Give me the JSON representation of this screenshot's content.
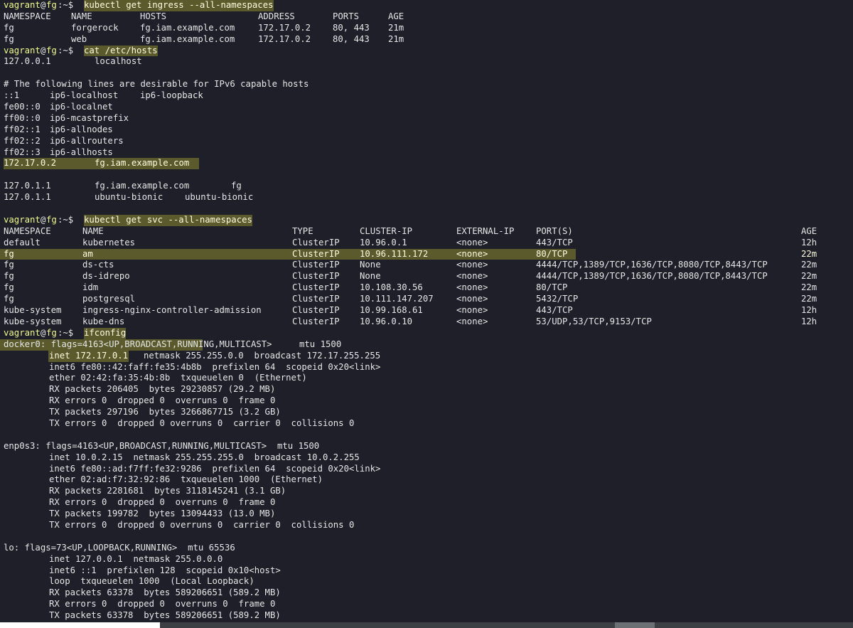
{
  "prompt": {
    "user": "vagrant",
    "at": "@",
    "host": "fg",
    "sep": ":~$ "
  },
  "cmd1": "kubectl get ingress --all-namespaces",
  "ingress": {
    "headers": [
      "NAMESPACE",
      "NAME",
      "HOSTS",
      "ADDRESS",
      "PORTS",
      "AGE"
    ],
    "rows": [
      [
        "fg",
        "forgerock",
        "fg.iam.example.com",
        "172.17.0.2",
        "80, 443",
        "21m"
      ],
      [
        "fg",
        "web",
        "fg.iam.example.com",
        "172.17.0.2",
        "80, 443",
        "21m"
      ]
    ]
  },
  "cmd2": "cat /etc/hosts",
  "hosts": {
    "l1a": "127.0.0.1",
    "l1b": "localhost",
    "comment": "# The following lines are desirable for IPv6 capable hosts",
    "v6": [
      [
        "::1",
        "ip6-localhost",
        "ip6-loopback"
      ],
      [
        "fe00::0",
        "ip6-localnet",
        ""
      ],
      [
        "ff00::0",
        "ip6-mcastprefix",
        ""
      ],
      [
        "ff02::1",
        "ip6-allnodes",
        ""
      ],
      [
        "ff02::2",
        "ip6-allrouters",
        ""
      ],
      [
        "ff02::3",
        "ip6-allhosts",
        ""
      ]
    ],
    "hl_ip": "172.17.0.2",
    "hl_host": "fg.iam.example.com",
    "e1": [
      "127.0.1.1",
      "fg.iam.example.com",
      "fg"
    ],
    "e2": [
      "127.0.1.1",
      "ubuntu-bionic",
      "ubuntu-bionic"
    ]
  },
  "cmd3": "kubectl get svc --all-namespaces",
  "svc": {
    "headers": [
      "NAMESPACE",
      "NAME",
      "TYPE",
      "CLUSTER-IP",
      "EXTERNAL-IP",
      "PORT(S)",
      "AGE"
    ],
    "rows": [
      [
        "default",
        "kubernetes",
        "ClusterIP",
        "10.96.0.1",
        "<none>",
        "443/TCP",
        "12h"
      ],
      [
        "fg",
        "am",
        "ClusterIP",
        "10.96.111.172",
        "<none>",
        "80/TCP",
        "22m"
      ],
      [
        "fg",
        "ds-cts",
        "ClusterIP",
        "None",
        "<none>",
        "4444/TCP,1389/TCP,1636/TCP,8080/TCP,8443/TCP",
        "22m"
      ],
      [
        "fg",
        "ds-idrepo",
        "ClusterIP",
        "None",
        "<none>",
        "4444/TCP,1389/TCP,1636/TCP,8080/TCP,8443/TCP",
        "22m"
      ],
      [
        "fg",
        "idm",
        "ClusterIP",
        "10.108.30.56",
        "<none>",
        "80/TCP",
        "22m"
      ],
      [
        "fg",
        "postgresql",
        "ClusterIP",
        "10.111.147.207",
        "<none>",
        "5432/TCP",
        "22m"
      ],
      [
        "kube-system",
        "ingress-nginx-controller-admission",
        "ClusterIP",
        "10.99.168.61",
        "<none>",
        "443/TCP",
        "12h"
      ],
      [
        "kube-system",
        "kube-dns",
        "ClusterIP",
        "10.96.0.10",
        "<none>",
        "53/UDP,53/TCP,9153/TCP",
        "12h"
      ]
    ]
  },
  "cmd4": "ifconfig",
  "docker0": {
    "flags": "docker0: flags=4163<UP,BROADCAST,RUNNING,MULTICAST>",
    "mtu": "mtu 1500",
    "inet": "inet 172.17.0.1",
    "inet_rest": "netmask 255.255.0.0  broadcast 172.17.255.255",
    "lines": [
      "inet6 fe80::42:faff:fe35:4b8b  prefixlen 64  scopeid 0x20<link>",
      "ether 02:42:fa:35:4b:8b  txqueuelen 0  (Ethernet)",
      "RX packets 206405  bytes 29230857 (29.2 MB)",
      "RX errors 0  dropped 0  overruns 0  frame 0",
      "TX packets 297196  bytes 3266867715 (3.2 GB)",
      "TX errors 0  dropped 0 overruns 0  carrier 0  collisions 0"
    ]
  },
  "enp0s3": {
    "flags": "enp0s3: flags=4163<UP,BROADCAST,RUNNING,MULTICAST>  mtu 1500",
    "lines": [
      "inet 10.0.2.15  netmask 255.255.255.0  broadcast 10.0.2.255",
      "inet6 fe80::ad:f7ff:fe32:9286  prefixlen 64  scopeid 0x20<link>",
      "ether 02:ad:f7:32:92:86  txqueuelen 1000  (Ethernet)",
      "RX packets 2281681  bytes 3118145241 (3.1 GB)",
      "RX errors 0  dropped 0  overruns 0  frame 0",
      "TX packets 199782  bytes 13094433 (13.0 MB)",
      "TX errors 0  dropped 0 overruns 0  carrier 0  collisions 0"
    ]
  },
  "lo": {
    "flags": "lo: flags=73<UP,LOOPBACK,RUNNING>  mtu 65536",
    "lines": [
      "inet 127.0.0.1  netmask 255.0.0.0",
      "inet6 ::1  prefixlen 128  scopeid 0x10<host>",
      "loop  txqueuelen 1000  (Local Loopback)",
      "RX packets 63378  bytes 589206651 (589.2 MB)",
      "RX errors 0  dropped 0  overruns 0  frame 0",
      "TX packets 63378  bytes 589206651 (589.2 MB)"
    ]
  }
}
